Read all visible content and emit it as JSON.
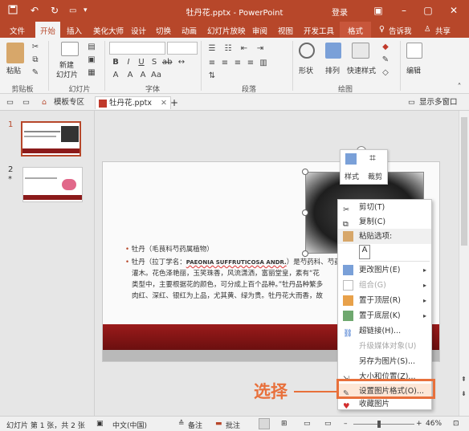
{
  "window": {
    "title": "牡丹花.pptx - PowerPoint",
    "login": "登录"
  },
  "ribbon_tabs": [
    "文件",
    "开始",
    "插入",
    "美化大师",
    "设计",
    "切换",
    "动画",
    "幻灯片放映",
    "审阅",
    "视图",
    "开发工具",
    "格式"
  ],
  "tell_me": "告诉我",
  "share": "共享",
  "ribbon": {
    "paste": "粘贴",
    "new_slide_line1": "新建",
    "new_slide_line2": "幻灯片",
    "shape": "形状",
    "arrange": "排列",
    "quick_styles": "快速样式",
    "edit": "编辑",
    "groups": [
      "剪贴板",
      "幻灯片",
      "字体",
      "段落",
      "绘图"
    ]
  },
  "doc_tabs": {
    "templates": "模板专区",
    "file": "牡丹花.pptx",
    "show_multi": "显示多窗口"
  },
  "thumbnails": [
    {
      "num": "1"
    },
    {
      "num": "2",
      "mark": "*"
    }
  ],
  "float_toolbar": {
    "style": "样式",
    "crop": "裁剪"
  },
  "slide": {
    "bullet1": "牡丹（毛茛科芍药属植物）",
    "bullet2_prefix": "牡丹（拉丁学名：",
    "latin": "PAEONIA SUFFRUTICOSA ANDR.",
    "bullet2_suffix": "）是芍药科、芍药属",
    "line2": "灌木。花色泽艳丽，玉笑珠香，风流潇洒，富丽堂皇，素有“花",
    "line3": "类型中，主要根据花的颜色，可分成上百个品种。”牡丹品种繁多",
    "line4": "肉红、深红、银红为上品，尤其黄、绿为贵。牡丹花大而香，故"
  },
  "context_menu": {
    "items": [
      {
        "label": "剪切(T)",
        "icon": "scissors-icon",
        "disabled": false,
        "arrow": false
      },
      {
        "label": "复制(C)",
        "icon": "copy-icon",
        "disabled": false,
        "arrow": false
      },
      {
        "label": "粘贴选项:",
        "icon": "paste-options-icon",
        "disabled": false,
        "arrow": false
      },
      {
        "label": "更改图片(E)",
        "icon": "change-picture-icon",
        "disabled": false,
        "arrow": true
      },
      {
        "label": "组合(G)",
        "icon": "group-icon",
        "disabled": true,
        "arrow": true
      },
      {
        "label": "置于顶层(R)",
        "icon": "bring-front-icon",
        "disabled": false,
        "arrow": true
      },
      {
        "label": "置于底层(K)",
        "icon": "send-back-icon",
        "disabled": false,
        "arrow": true
      },
      {
        "label": "超链接(H)...",
        "icon": "hyperlink-icon",
        "disabled": false,
        "arrow": false
      },
      {
        "label": "升级媒体对象(U)",
        "icon": "",
        "disabled": true,
        "arrow": false
      },
      {
        "label": "另存为图片(S)...",
        "icon": "",
        "disabled": false,
        "arrow": false
      },
      {
        "label": "大小和位置(Z)...",
        "icon": "size-position-icon",
        "disabled": false,
        "arrow": false
      },
      {
        "label": "设置图片格式(O)...",
        "icon": "format-picture-icon",
        "disabled": false,
        "arrow": false
      },
      {
        "label": "收藏图片",
        "icon": "heart-icon",
        "disabled": false,
        "arrow": false
      }
    ]
  },
  "annotation": {
    "text": "选择"
  },
  "status_bar": {
    "slide_info": "幻灯片 第 1 张，共 2 张",
    "language": "中文(中国)",
    "notes": "备注",
    "comments": "批注",
    "zoom": "46%"
  },
  "colors": {
    "brand": "#b7472a",
    "highlight": "#e8703b"
  }
}
